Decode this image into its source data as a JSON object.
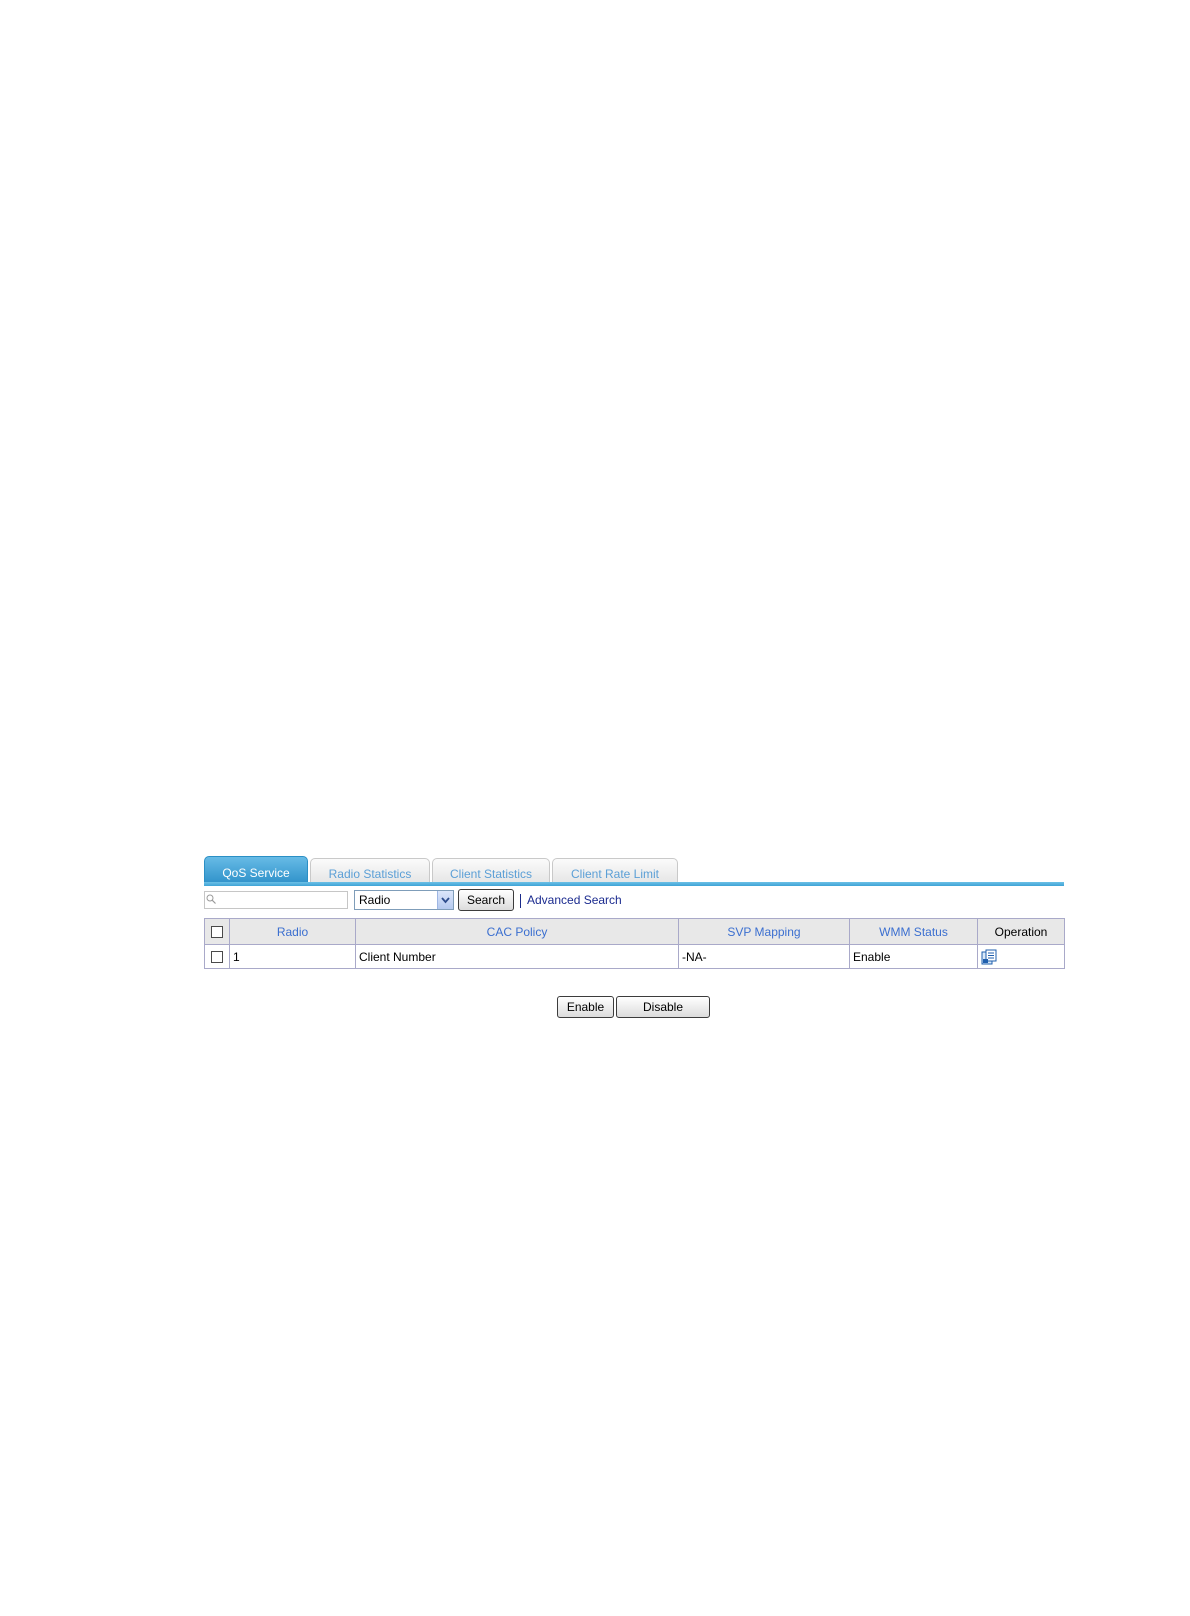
{
  "tabs": [
    {
      "label": "QoS Service",
      "active": true
    },
    {
      "label": "Radio Statistics",
      "active": false
    },
    {
      "label": "Client Statistics",
      "active": false
    },
    {
      "label": "Client Rate Limit",
      "active": false
    }
  ],
  "search": {
    "placeholder": "",
    "filter_selected": "Radio",
    "search_label": "Search",
    "advanced_label": "Advanced Search"
  },
  "table": {
    "headers": [
      "Radio",
      "CAC Policy",
      "SVP Mapping",
      "WMM Status",
      "Operation"
    ],
    "rows": [
      {
        "radio": "1",
        "cac_policy": "Client Number",
        "svp_mapping": "-NA-",
        "wmm_status": "Enable"
      }
    ]
  },
  "actions": {
    "enable_label": "Enable",
    "disable_label": "Disable"
  },
  "colors": {
    "tab_active": "#2a8ec7",
    "tab_text": "#5b9fd6",
    "header_link": "#3b6fd0",
    "advanced_link": "#1b2b8f"
  },
  "icons": {
    "search": "search-icon",
    "select_arrow": "chevron-down-icon",
    "operation": "edit-details-icon"
  }
}
